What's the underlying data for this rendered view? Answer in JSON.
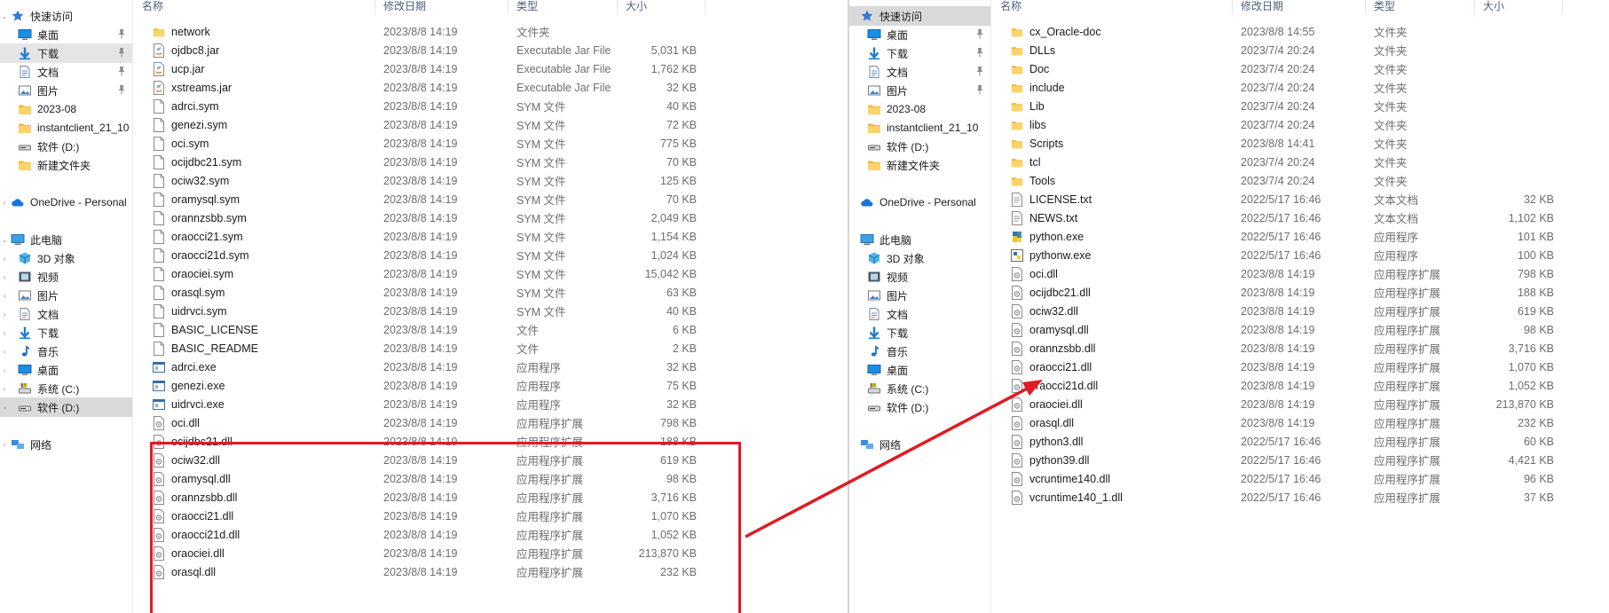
{
  "colors": {
    "highlight": "#e01b24",
    "selected_nav": "#d9d9d9",
    "folder": "#f6c859",
    "text_gray": "#6d6d6d"
  },
  "left_window": {
    "nav": [
      {
        "label": "快速访问",
        "icon": "star-icon",
        "chev": "v",
        "indent": 0,
        "pin": false
      },
      {
        "label": "桌面",
        "icon": "desktop-icon",
        "chev": "",
        "indent": 1,
        "pin": true
      },
      {
        "label": "下载",
        "icon": "download-icon",
        "chev": "",
        "indent": 1,
        "pin": true,
        "state": "hl"
      },
      {
        "label": "文档",
        "icon": "document-icon",
        "chev": "",
        "indent": 1,
        "pin": true
      },
      {
        "label": "图片",
        "icon": "picture-icon",
        "chev": "",
        "indent": 1,
        "pin": true
      },
      {
        "label": "2023-08",
        "icon": "folder-icon",
        "chev": "",
        "indent": 1,
        "pin": false
      },
      {
        "label": "instantclient_21_10",
        "icon": "folder-icon",
        "chev": "",
        "indent": 1,
        "pin": false
      },
      {
        "label": "软件 (D:)",
        "icon": "drive-icon",
        "chev": "",
        "indent": 1,
        "pin": false
      },
      {
        "label": "新建文件夹",
        "icon": "folder-icon",
        "chev": "",
        "indent": 1,
        "pin": false
      },
      {
        "label": "",
        "icon": "",
        "chev": "",
        "indent": 0,
        "pin": false
      },
      {
        "label": "OneDrive - Personal",
        "icon": "cloud-icon",
        "chev": ">",
        "indent": 0,
        "pin": false
      },
      {
        "label": "",
        "icon": "",
        "chev": "",
        "indent": 0,
        "pin": false
      },
      {
        "label": "此电脑",
        "icon": "computer-icon",
        "chev": "v",
        "indent": 0,
        "pin": false
      },
      {
        "label": "3D 对象",
        "icon": "cube-icon",
        "chev": ">",
        "indent": 1,
        "pin": false
      },
      {
        "label": "视频",
        "icon": "video-icon",
        "chev": ">",
        "indent": 1,
        "pin": false
      },
      {
        "label": "图片",
        "icon": "picture-icon",
        "chev": ">",
        "indent": 1,
        "pin": false
      },
      {
        "label": "文档",
        "icon": "document-icon",
        "chev": ">",
        "indent": 1,
        "pin": false
      },
      {
        "label": "下载",
        "icon": "download-icon",
        "chev": ">",
        "indent": 1,
        "pin": false
      },
      {
        "label": "音乐",
        "icon": "music-icon",
        "chev": ">",
        "indent": 1,
        "pin": false
      },
      {
        "label": "桌面",
        "icon": "desktop-icon",
        "chev": ">",
        "indent": 1,
        "pin": false
      },
      {
        "label": "系统 (C:)",
        "icon": "system-drive-icon",
        "chev": ">",
        "indent": 1,
        "pin": false
      },
      {
        "label": "软件 (D:)",
        "icon": "drive-icon",
        "chev": ">",
        "indent": 1,
        "pin": false,
        "state": "selected"
      },
      {
        "label": "",
        "icon": "",
        "chev": "",
        "indent": 0,
        "pin": false
      },
      {
        "label": "网络",
        "icon": "network-icon",
        "chev": ">",
        "indent": 0,
        "pin": false
      }
    ],
    "columns": {
      "name": "名称",
      "date": "修改日期",
      "type": "类型",
      "size": "大小"
    },
    "files": [
      {
        "name": "network",
        "date": "2023/8/8 14:19",
        "type": "文件夹",
        "size": "",
        "icon": "folder-icon"
      },
      {
        "name": "ojdbc8.jar",
        "date": "2023/8/8 14:19",
        "type": "Executable Jar File",
        "size": "5,031 KB",
        "icon": "jar-icon"
      },
      {
        "name": "ucp.jar",
        "date": "2023/8/8 14:19",
        "type": "Executable Jar File",
        "size": "1,762 KB",
        "icon": "jar-icon"
      },
      {
        "name": "xstreams.jar",
        "date": "2023/8/8 14:19",
        "type": "Executable Jar File",
        "size": "32 KB",
        "icon": "jar-icon"
      },
      {
        "name": "adrci.sym",
        "date": "2023/8/8 14:19",
        "type": "SYM 文件",
        "size": "40 KB",
        "icon": "file-icon"
      },
      {
        "name": "genezi.sym",
        "date": "2023/8/8 14:19",
        "type": "SYM 文件",
        "size": "72 KB",
        "icon": "file-icon"
      },
      {
        "name": "oci.sym",
        "date": "2023/8/8 14:19",
        "type": "SYM 文件",
        "size": "775 KB",
        "icon": "file-icon"
      },
      {
        "name": "ocijdbc21.sym",
        "date": "2023/8/8 14:19",
        "type": "SYM 文件",
        "size": "70 KB",
        "icon": "file-icon"
      },
      {
        "name": "ociw32.sym",
        "date": "2023/8/8 14:19",
        "type": "SYM 文件",
        "size": "125 KB",
        "icon": "file-icon"
      },
      {
        "name": "oramysql.sym",
        "date": "2023/8/8 14:19",
        "type": "SYM 文件",
        "size": "70 KB",
        "icon": "file-icon"
      },
      {
        "name": "orannzsbb.sym",
        "date": "2023/8/8 14:19",
        "type": "SYM 文件",
        "size": "2,049 KB",
        "icon": "file-icon"
      },
      {
        "name": "oraocci21.sym",
        "date": "2023/8/8 14:19",
        "type": "SYM 文件",
        "size": "1,154 KB",
        "icon": "file-icon"
      },
      {
        "name": "oraocci21d.sym",
        "date": "2023/8/8 14:19",
        "type": "SYM 文件",
        "size": "1,024 KB",
        "icon": "file-icon"
      },
      {
        "name": "oraociei.sym",
        "date": "2023/8/8 14:19",
        "type": "SYM 文件",
        "size": "15,042 KB",
        "icon": "file-icon"
      },
      {
        "name": "orasql.sym",
        "date": "2023/8/8 14:19",
        "type": "SYM 文件",
        "size": "63 KB",
        "icon": "file-icon"
      },
      {
        "name": "uidrvci.sym",
        "date": "2023/8/8 14:19",
        "type": "SYM 文件",
        "size": "40 KB",
        "icon": "file-icon"
      },
      {
        "name": "BASIC_LICENSE",
        "date": "2023/8/8 14:19",
        "type": "文件",
        "size": "6 KB",
        "icon": "file-icon"
      },
      {
        "name": "BASIC_README",
        "date": "2023/8/8 14:19",
        "type": "文件",
        "size": "2 KB",
        "icon": "file-icon"
      },
      {
        "name": "adrci.exe",
        "date": "2023/8/8 14:19",
        "type": "应用程序",
        "size": "32 KB",
        "icon": "exe-icon"
      },
      {
        "name": "genezi.exe",
        "date": "2023/8/8 14:19",
        "type": "应用程序",
        "size": "75 KB",
        "icon": "exe-icon"
      },
      {
        "name": "uidrvci.exe",
        "date": "2023/8/8 14:19",
        "type": "应用程序",
        "size": "32 KB",
        "icon": "exe-icon"
      },
      {
        "name": "oci.dll",
        "date": "2023/8/8 14:19",
        "type": "应用程序扩展",
        "size": "798 KB",
        "icon": "dll-icon"
      },
      {
        "name": "ocijdbc21.dll",
        "date": "2023/8/8 14:19",
        "type": "应用程序扩展",
        "size": "188 KB",
        "icon": "dll-icon"
      },
      {
        "name": "ociw32.dll",
        "date": "2023/8/8 14:19",
        "type": "应用程序扩展",
        "size": "619 KB",
        "icon": "dll-icon"
      },
      {
        "name": "oramysql.dll",
        "date": "2023/8/8 14:19",
        "type": "应用程序扩展",
        "size": "98 KB",
        "icon": "dll-icon"
      },
      {
        "name": "orannzsbb.dll",
        "date": "2023/8/8 14:19",
        "type": "应用程序扩展",
        "size": "3,716 KB",
        "icon": "dll-icon"
      },
      {
        "name": "oraocci21.dll",
        "date": "2023/8/8 14:19",
        "type": "应用程序扩展",
        "size": "1,070 KB",
        "icon": "dll-icon"
      },
      {
        "name": "oraocci21d.dll",
        "date": "2023/8/8 14:19",
        "type": "应用程序扩展",
        "size": "1,052 KB",
        "icon": "dll-icon"
      },
      {
        "name": "oraociei.dll",
        "date": "2023/8/8 14:19",
        "type": "应用程序扩展",
        "size": "213,870 KB",
        "icon": "dll-icon"
      },
      {
        "name": "orasql.dll",
        "date": "2023/8/8 14:19",
        "type": "应用程序扩展",
        "size": "232 KB",
        "icon": "dll-icon"
      }
    ]
  },
  "right_window": {
    "nav": [
      {
        "label": "快速访问",
        "icon": "star-icon",
        "chev": "",
        "indent": 0,
        "pin": false,
        "state": "selected"
      },
      {
        "label": "桌面",
        "icon": "desktop-icon",
        "chev": "",
        "indent": 1,
        "pin": true
      },
      {
        "label": "下载",
        "icon": "download-icon",
        "chev": "",
        "indent": 1,
        "pin": true
      },
      {
        "label": "文档",
        "icon": "document-icon",
        "chev": "",
        "indent": 1,
        "pin": true
      },
      {
        "label": "图片",
        "icon": "picture-icon",
        "chev": "",
        "indent": 1,
        "pin": true
      },
      {
        "label": "2023-08",
        "icon": "folder-icon",
        "chev": "",
        "indent": 1,
        "pin": false
      },
      {
        "label": "instantclient_21_10",
        "icon": "folder-icon",
        "chev": "",
        "indent": 1,
        "pin": false
      },
      {
        "label": "软件 (D:)",
        "icon": "drive-icon",
        "chev": "",
        "indent": 1,
        "pin": false
      },
      {
        "label": "新建文件夹",
        "icon": "folder-icon",
        "chev": "",
        "indent": 1,
        "pin": false
      },
      {
        "label": "",
        "icon": "",
        "chev": "",
        "indent": 0,
        "pin": false
      },
      {
        "label": "OneDrive - Personal",
        "icon": "cloud-icon",
        "chev": "",
        "indent": 0,
        "pin": false
      },
      {
        "label": "",
        "icon": "",
        "chev": "",
        "indent": 0,
        "pin": false
      },
      {
        "label": "此电脑",
        "icon": "computer-icon",
        "chev": "",
        "indent": 0,
        "pin": false
      },
      {
        "label": "3D 对象",
        "icon": "cube-icon",
        "chev": "",
        "indent": 1,
        "pin": false
      },
      {
        "label": "视频",
        "icon": "video-icon",
        "chev": "",
        "indent": 1,
        "pin": false
      },
      {
        "label": "图片",
        "icon": "picture-icon",
        "chev": "",
        "indent": 1,
        "pin": false
      },
      {
        "label": "文档",
        "icon": "document-icon",
        "chev": "",
        "indent": 1,
        "pin": false
      },
      {
        "label": "下载",
        "icon": "download-icon",
        "chev": "",
        "indent": 1,
        "pin": false
      },
      {
        "label": "音乐",
        "icon": "music-icon",
        "chev": "",
        "indent": 1,
        "pin": false
      },
      {
        "label": "桌面",
        "icon": "desktop-icon",
        "chev": "",
        "indent": 1,
        "pin": false
      },
      {
        "label": "系统 (C:)",
        "icon": "system-drive-icon",
        "chev": "",
        "indent": 1,
        "pin": false
      },
      {
        "label": "软件 (D:)",
        "icon": "drive-icon",
        "chev": "",
        "indent": 1,
        "pin": false
      },
      {
        "label": "",
        "icon": "",
        "chev": "",
        "indent": 0,
        "pin": false
      },
      {
        "label": "网络",
        "icon": "network-icon",
        "chev": "",
        "indent": 0,
        "pin": false
      }
    ],
    "columns": {
      "name": "名称",
      "date": "修改日期",
      "type": "类型",
      "size": "大小"
    },
    "files": [
      {
        "name": "cx_Oracle-doc",
        "date": "2023/8/8 14:55",
        "type": "文件夹",
        "size": "",
        "icon": "folder-icon"
      },
      {
        "name": "DLLs",
        "date": "2023/7/4 20:24",
        "type": "文件夹",
        "size": "",
        "icon": "folder-icon"
      },
      {
        "name": "Doc",
        "date": "2023/7/4 20:24",
        "type": "文件夹",
        "size": "",
        "icon": "folder-icon"
      },
      {
        "name": "include",
        "date": "2023/7/4 20:24",
        "type": "文件夹",
        "size": "",
        "icon": "folder-icon"
      },
      {
        "name": "Lib",
        "date": "2023/7/4 20:24",
        "type": "文件夹",
        "size": "",
        "icon": "folder-icon"
      },
      {
        "name": "libs",
        "date": "2023/7/4 20:24",
        "type": "文件夹",
        "size": "",
        "icon": "folder-icon"
      },
      {
        "name": "Scripts",
        "date": "2023/8/8 14:41",
        "type": "文件夹",
        "size": "",
        "icon": "folder-icon"
      },
      {
        "name": "tcl",
        "date": "2023/7/4 20:24",
        "type": "文件夹",
        "size": "",
        "icon": "folder-icon"
      },
      {
        "name": "Tools",
        "date": "2023/7/4 20:24",
        "type": "文件夹",
        "size": "",
        "icon": "folder-icon"
      },
      {
        "name": "LICENSE.txt",
        "date": "2022/5/17 16:46",
        "type": "文本文档",
        "size": "32 KB",
        "icon": "text-file-icon"
      },
      {
        "name": "NEWS.txt",
        "date": "2022/5/17 16:46",
        "type": "文本文档",
        "size": "1,102 KB",
        "icon": "text-file-icon"
      },
      {
        "name": "python.exe",
        "date": "2022/5/17 16:46",
        "type": "应用程序",
        "size": "101 KB",
        "icon": "python-icon"
      },
      {
        "name": "pythonw.exe",
        "date": "2022/5/17 16:46",
        "type": "应用程序",
        "size": "100 KB",
        "icon": "pythonw-icon"
      },
      {
        "name": "oci.dll",
        "date": "2023/8/8 14:19",
        "type": "应用程序扩展",
        "size": "798 KB",
        "icon": "dll-icon"
      },
      {
        "name": "ocijdbc21.dll",
        "date": "2023/8/8 14:19",
        "type": "应用程序扩展",
        "size": "188 KB",
        "icon": "dll-icon"
      },
      {
        "name": "ociw32.dll",
        "date": "2023/8/8 14:19",
        "type": "应用程序扩展",
        "size": "619 KB",
        "icon": "dll-icon"
      },
      {
        "name": "oramysql.dll",
        "date": "2023/8/8 14:19",
        "type": "应用程序扩展",
        "size": "98 KB",
        "icon": "dll-icon"
      },
      {
        "name": "orannzsbb.dll",
        "date": "2023/8/8 14:19",
        "type": "应用程序扩展",
        "size": "3,716 KB",
        "icon": "dll-icon"
      },
      {
        "name": "oraocci21.dll",
        "date": "2023/8/8 14:19",
        "type": "应用程序扩展",
        "size": "1,070 KB",
        "icon": "dll-icon"
      },
      {
        "name": "oraocci21d.dll",
        "date": "2023/8/8 14:19",
        "type": "应用程序扩展",
        "size": "1,052 KB",
        "icon": "dll-icon"
      },
      {
        "name": "oraociei.dll",
        "date": "2023/8/8 14:19",
        "type": "应用程序扩展",
        "size": "213,870 KB",
        "icon": "dll-icon"
      },
      {
        "name": "orasql.dll",
        "date": "2023/8/8 14:19",
        "type": "应用程序扩展",
        "size": "232 KB",
        "icon": "dll-icon"
      },
      {
        "name": "python3.dll",
        "date": "2022/5/17 16:46",
        "type": "应用程序扩展",
        "size": "60 KB",
        "icon": "dll-icon"
      },
      {
        "name": "python39.dll",
        "date": "2022/5/17 16:46",
        "type": "应用程序扩展",
        "size": "4,421 KB",
        "icon": "dll-icon"
      },
      {
        "name": "vcruntime140.dll",
        "date": "2022/5/17 16:46",
        "type": "应用程序扩展",
        "size": "96 KB",
        "icon": "dll-icon"
      },
      {
        "name": "vcruntime140_1.dll",
        "date": "2022/5/17 16:46",
        "type": "应用程序扩展",
        "size": "37 KB",
        "icon": "dll-icon"
      }
    ]
  }
}
